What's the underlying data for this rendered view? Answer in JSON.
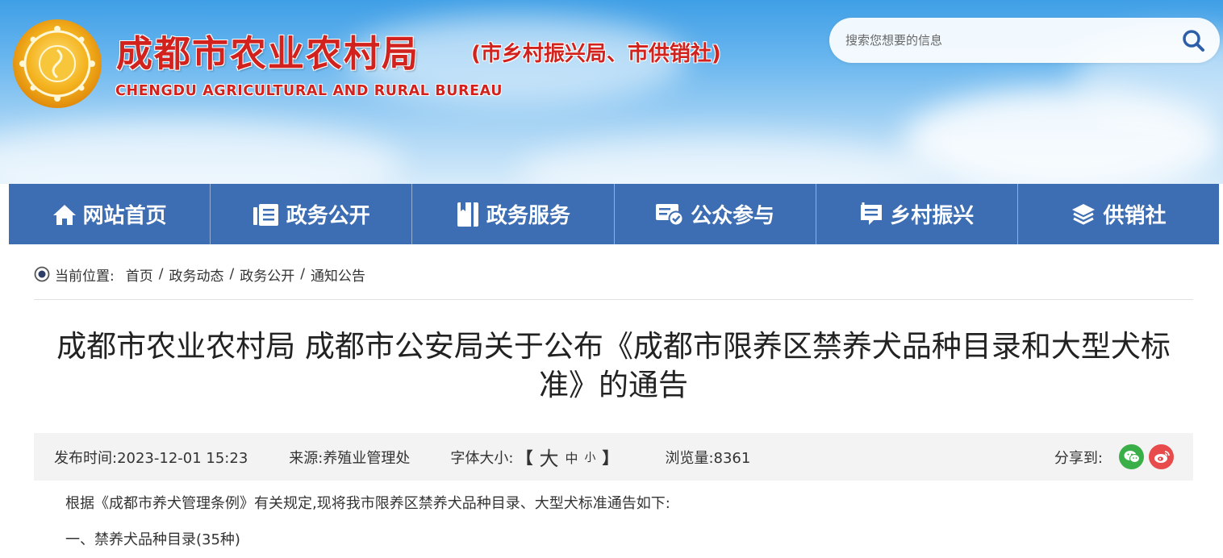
{
  "header": {
    "title_cn": "成都市农业农村局",
    "title_sub": "(市乡村振兴局、市供销社)",
    "title_en": "CHENGDU AGRICULTURAL AND RURAL BUREAU"
  },
  "search": {
    "placeholder": "搜索您想要的信息"
  },
  "nav": {
    "items": [
      {
        "label": "网站首页",
        "icon": "home-icon"
      },
      {
        "label": "政务公开",
        "icon": "document-list-icon"
      },
      {
        "label": "政务服务",
        "icon": "book-icon"
      },
      {
        "label": "公众参与",
        "icon": "message-check-icon"
      },
      {
        "label": "乡村振兴",
        "icon": "chat-notes-icon"
      },
      {
        "label": "供销社",
        "icon": "layers-icon"
      }
    ]
  },
  "breadcrumb": {
    "label": "当前位置:",
    "items": [
      "首页",
      "政务动态",
      "政务公开",
      "通知公告"
    ],
    "separator": "/"
  },
  "article": {
    "title_line1": "成都市农业农村局 成都市公安局关于公布《成都市限养区禁养犬品种目录和大型犬标",
    "title_line2": "准》的通告",
    "meta": {
      "publish_label": "发布时间:",
      "publish_time": "2023-12-01 15:23",
      "source_label": "来源:",
      "source": "养殖业管理处",
      "font_size_label": "字体大小:",
      "bracket_open": "【",
      "font_big": "大",
      "font_mid": "中",
      "font_small": "小",
      "bracket_close": "】",
      "views_label": "浏览量:",
      "views": "8361",
      "share_label": "分享到:"
    },
    "paragraphs": [
      "根据《成都市养犬管理条例》有关规定,现将我市限养区禁养犬品种目录、大型犬标准通告如下:",
      "一、禁养犬品种目录(35种)"
    ]
  },
  "colors": {
    "brand_red": "#d2221e",
    "nav_blue": "#3d6db2",
    "meta_bg": "#f3f3f3",
    "wechat_green": "#3aae47",
    "weibo_red": "#e84b4b"
  }
}
